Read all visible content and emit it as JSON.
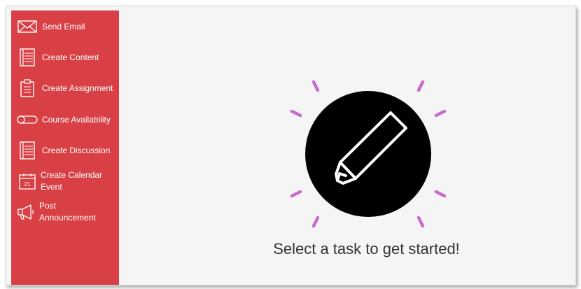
{
  "sidebar": {
    "items": [
      {
        "label": "Send Email",
        "icon": "envelope-icon"
      },
      {
        "label": "Create Content",
        "icon": "notebook-icon"
      },
      {
        "label": "Create Assignment",
        "icon": "clipboard-icon"
      },
      {
        "label": "Course Availability",
        "icon": "toggle-icon"
      },
      {
        "label": "Create Discussion",
        "icon": "notebook-icon"
      },
      {
        "label": "Create Calendar Event",
        "icon": "calendar-icon",
        "icon_text": "21"
      },
      {
        "label": "Post Announcement",
        "icon": "megaphone-icon"
      }
    ]
  },
  "main": {
    "message": "Select a task to get started!",
    "hero_icon": "pencil-icon"
  },
  "colors": {
    "sidebar_bg": "#d94045",
    "accent_rays": "#c86bcf",
    "hero_circle": "#000000",
    "background": "#f5f5f5"
  }
}
